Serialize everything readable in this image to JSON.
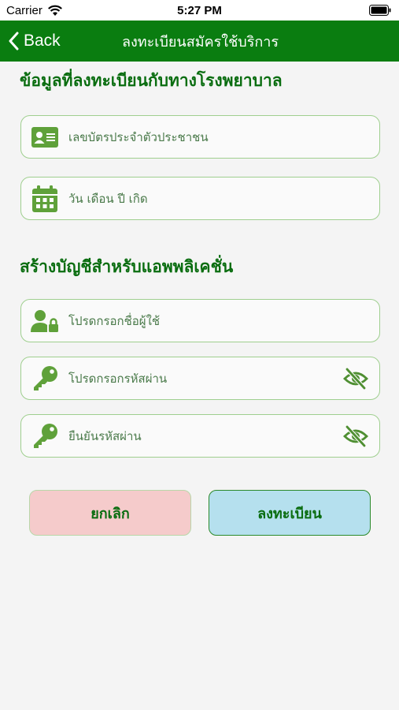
{
  "status_bar": {
    "carrier": "Carrier",
    "time": "5:27 PM"
  },
  "nav": {
    "back_label": "Back",
    "title": "ลงทะเบียนสมัครใช้บริการ"
  },
  "section_hospital": {
    "title": "ข้อมูลที่ลงทะเบียนกับทางโรงพยาบาล",
    "id_card_placeholder": "เลขบัตรประจำตัวประชาชน",
    "birthdate_placeholder": "วัน เดือน ปี เกิด"
  },
  "section_account": {
    "title": "สร้างบัญชีสำหรับแอพพลิเคชั่น",
    "username_placeholder": "โปรดกรอกชื่อผู้ใช้",
    "password_placeholder": "โปรดกรอกรหัสผ่าน",
    "confirm_password_placeholder": "ยืนยันรหัสผ่าน"
  },
  "buttons": {
    "cancel_label": "ยกเลิก",
    "register_label": "ลงทะเบียน"
  },
  "colors": {
    "nav_green": "#0a7d10",
    "icon_green": "#5fa13a",
    "cancel_bg": "#f5cbcb",
    "register_bg": "#b5e0ee"
  }
}
